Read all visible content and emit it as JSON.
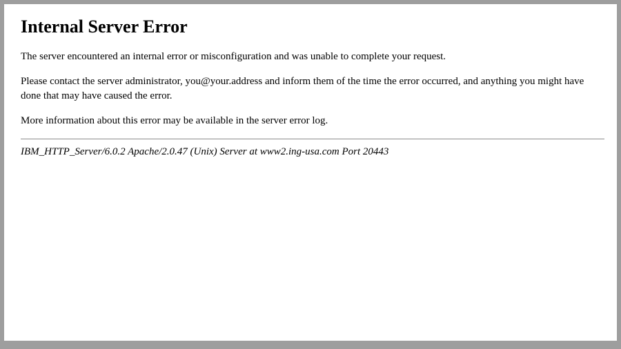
{
  "error": {
    "title": "Internal Server Error",
    "p1": "The server encountered an internal error or misconfiguration and was unable to complete your request.",
    "p2": "Please contact the server administrator, you@your.address and inform them of the time the error occurred, and anything you might have done that may have caused the error.",
    "p3": "More information about this error may be available in the server error log.",
    "server_signature": "IBM_HTTP_Server/6.0.2 Apache/2.0.47 (Unix) Server at www2.ing-usa.com Port 20443"
  }
}
